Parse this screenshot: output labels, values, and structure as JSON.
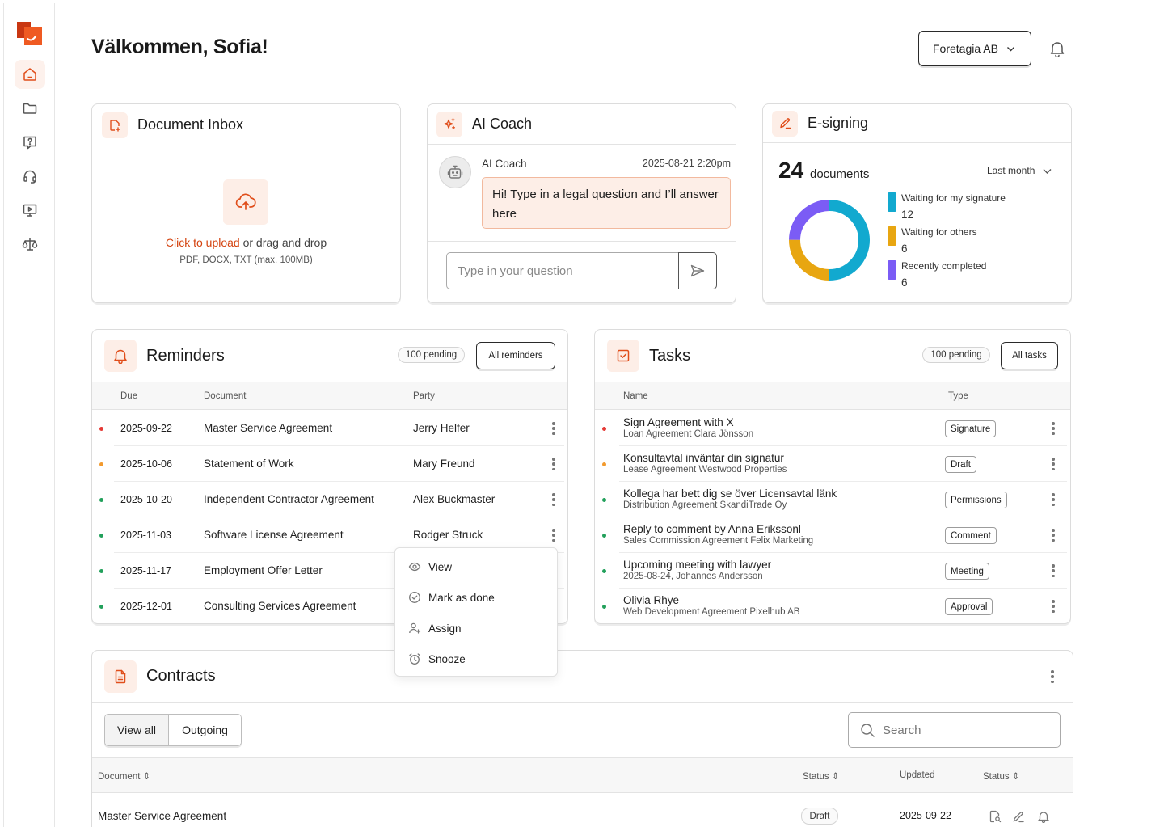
{
  "header": {
    "welcome": "Välkommen, Sofia!",
    "company": "Foretagia AB"
  },
  "colors": {
    "accent": "#e04e1b",
    "accent_soft": "#fdeee7",
    "dot_red": "#e53935",
    "dot_orange": "#f29a2e",
    "dot_green": "#22a05b",
    "waiting_me": "#12a9cf",
    "waiting_others": "#e8a611",
    "completed": "#7b5cf5"
  },
  "inbox": {
    "title": "Document Inbox",
    "upload_link": "Click to upload",
    "upload_rest": "or drag and drop",
    "formats": "PDF, DOCX, TXT  (max. 100MB)"
  },
  "coach": {
    "title": "AI Coach",
    "sender": "AI Coach",
    "time": "2025-08-21 2:20pm",
    "message": "Hi! Type in a legal question and I’ll answer here",
    "placeholder": "Type in your question"
  },
  "esign": {
    "title": "E-signing",
    "count": "24",
    "count_label": "documents",
    "period": "Last month",
    "legend": [
      {
        "label": "Waiting for my signature",
        "value": "12"
      },
      {
        "label": "Waiting for others",
        "value": "6"
      },
      {
        "label": "Recently completed",
        "value": "6"
      }
    ]
  },
  "reminders": {
    "title": "Reminders",
    "pending": "100 pending",
    "all_button": "All reminders",
    "columns": {
      "due": "Due",
      "document": "Document",
      "party": "Party"
    },
    "rows": [
      {
        "due": "2025-09-22",
        "document": "Master Service Agreement",
        "party": "Jerry Helfer",
        "status": "red"
      },
      {
        "due": "2025-10-06",
        "document": "Statement of Work",
        "party": "Mary Freund",
        "status": "orange"
      },
      {
        "due": "2025-10-20",
        "document": "Independent Contractor Agreement",
        "party": "Alex Buckmaster",
        "status": "green"
      },
      {
        "due": "2025-11-03",
        "document": "Software License Agreement",
        "party": "Rodger Struck",
        "status": "green"
      },
      {
        "due": "2025-11-17",
        "document": "Employment Offer Letter",
        "party": "",
        "status": "green"
      },
      {
        "due": "2025-12-01",
        "document": "Consulting Services Agreement",
        "party": "",
        "status": "green"
      }
    ]
  },
  "menu": {
    "items": [
      "View",
      "Mark as done",
      "Assign",
      "Snooze"
    ]
  },
  "tasks": {
    "title": "Tasks",
    "pending": "100 pending",
    "all_button": "All tasks",
    "columns": {
      "name": "Name",
      "type": "Type"
    },
    "rows": [
      {
        "title": "Sign Agreement with X",
        "sub": "Loan Agreement Clara Jönsson",
        "type": "Signature",
        "status": "red"
      },
      {
        "title": "Konsultavtal inväntar din signatur",
        "sub": "Lease Agreement Westwood Properties",
        "type": "Draft",
        "status": "orange"
      },
      {
        "title": "Kollega har bett dig se över Licensavtal länk",
        "sub": "Distribution Agreement SkandiTrade Oy",
        "type": "Permissions",
        "status": "green"
      },
      {
        "title": "Reply to comment by Anna Erikssonl",
        "sub": "Sales Commission Agreement Felix Marketing",
        "type": "Comment",
        "status": "green"
      },
      {
        "title": "Upcoming meeting with lawyer",
        "sub": "2025-08-24, Johannes Andersson",
        "type": "Meeting",
        "status": "green"
      },
      {
        "title": "Olivia Rhye",
        "sub": "Web Development Agreement Pixelhub AB",
        "type": "Approval",
        "status": "green"
      }
    ]
  },
  "contracts": {
    "title": "Contracts",
    "view_all": "View all",
    "outgoing": "Outgoing",
    "search_placeholder": "Search",
    "columns": {
      "document": "Document",
      "status": "Status",
      "updated": "Updated",
      "status2": "Status"
    },
    "rows": [
      {
        "document": "Master Service Agreement",
        "status": "Draft",
        "updated": "2025-09-22"
      }
    ]
  }
}
